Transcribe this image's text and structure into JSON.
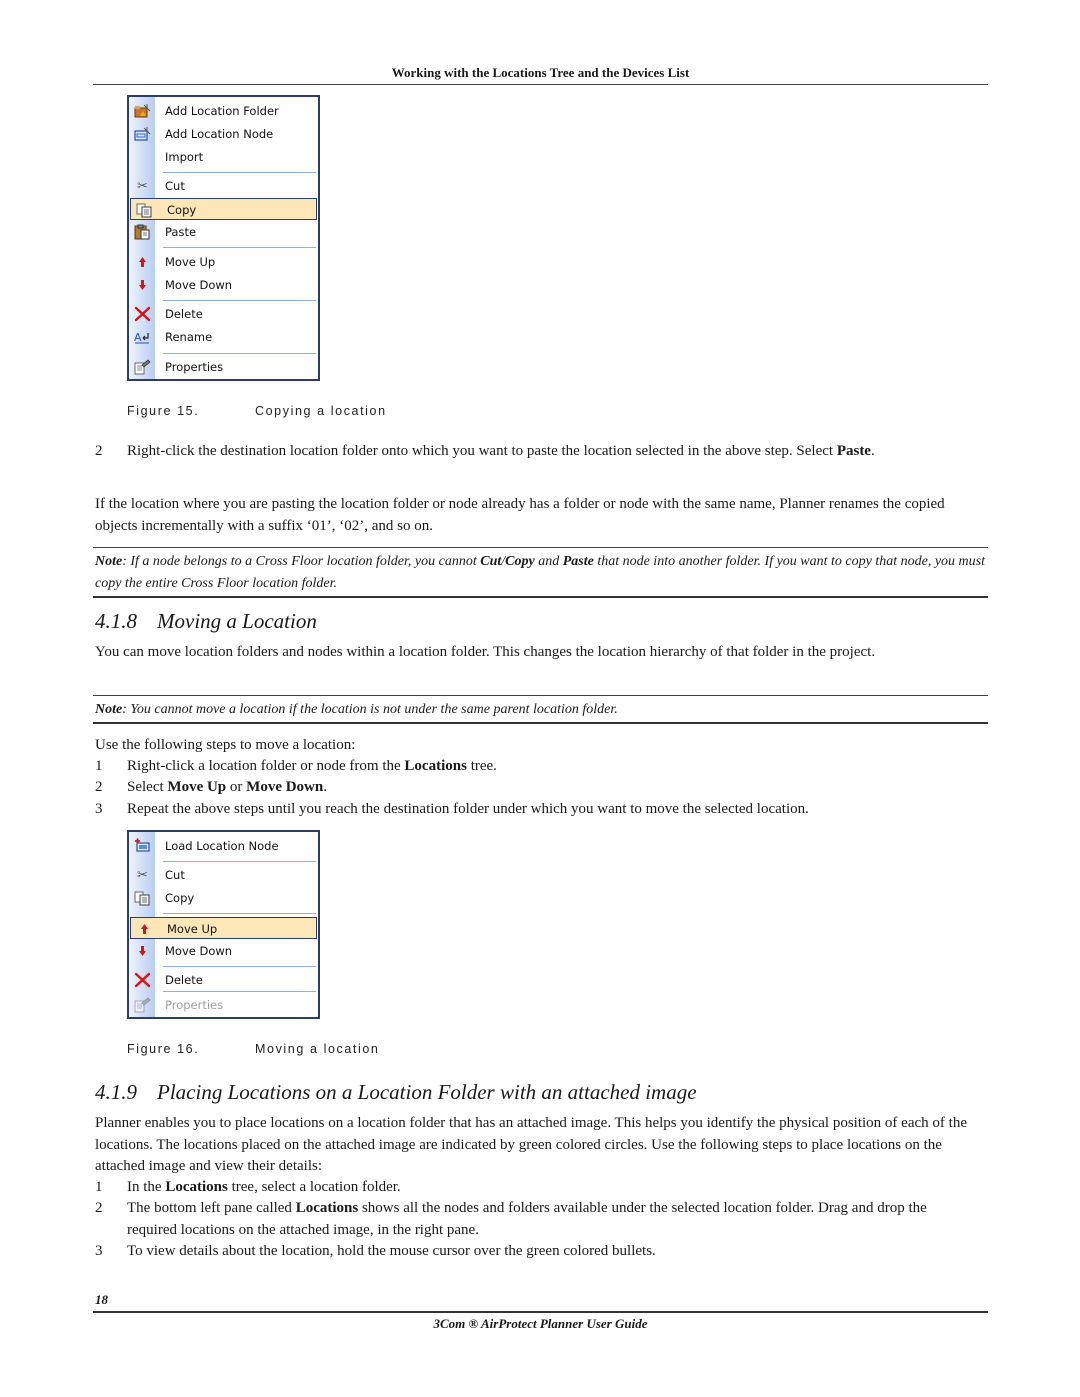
{
  "header": {
    "running_title": "Working with the Locations Tree and the Devices List"
  },
  "figure15": {
    "menu_items": [
      {
        "label": "Add Location Folder",
        "icon": "add-folder-icon"
      },
      {
        "label": "Add Location Node",
        "icon": "add-node-icon"
      },
      {
        "label": "Import",
        "icon": ""
      },
      {
        "label": "Cut",
        "icon": "scissors-icon"
      },
      {
        "label": "Copy",
        "icon": "copy-icon",
        "selected": true
      },
      {
        "label": "Paste",
        "icon": "paste-icon"
      },
      {
        "label": "Move Up",
        "icon": "arrow-up-icon"
      },
      {
        "label": "Move Down",
        "icon": "arrow-down-icon"
      },
      {
        "label": "Delete",
        "icon": "delete-x-icon"
      },
      {
        "label": "Rename",
        "icon": "rename-icon"
      },
      {
        "label": "Properties",
        "icon": "properties-icon"
      }
    ],
    "caption_number": "Figure 15.",
    "caption_text": "Copying a location"
  },
  "section_copy": {
    "step2_num": "2",
    "step2_text_a": "Right-click the destination location folder onto which you want to paste the location selected in the above step. Select ",
    "step2_bold": "Paste",
    "step2_text_b": ".",
    "paragraph": "If the location where you are pasting the location folder or node already has a folder or node with the same name, Planner renames the copied objects incrementally with a suffix ‘01’, ‘02’, and so on.",
    "note_label": "Note",
    "note_a": ": If a node belongs to a Cross Floor location folder, you cannot ",
    "note_b1": "Cut",
    "note_slash": "/",
    "note_b2": "Copy",
    "note_c": " and ",
    "note_b3": "Paste",
    "note_d": " that node into another folder. If you want to copy that node, you must copy the entire Cross Floor location folder."
  },
  "section_418": {
    "number": "4.1.8",
    "title": "Moving a Location",
    "paragraph": "You can move location folders and nodes within a location folder. This changes the location hierarchy of that folder in the project.",
    "note_label": "Note",
    "note_text": ": You cannot move a location if the location is not under the same parent location folder.",
    "intro": "Use the following steps to move a location:",
    "steps": [
      {
        "n": "1",
        "a": "Right-click a location folder or node from the ",
        "b": "Locations",
        "c": " tree."
      },
      {
        "n": "2",
        "a": "Select ",
        "b": "Move Up",
        "c": " or ",
        "d": "Move Down",
        "e": "."
      },
      {
        "n": "3",
        "a": "Repeat the above steps until you reach the destination folder under which you want to move the selected location."
      }
    ]
  },
  "figure16": {
    "menu_items": [
      {
        "label": "Load Location Node",
        "icon": "load-node-icon"
      },
      {
        "label": "Cut",
        "icon": "scissors-icon"
      },
      {
        "label": "Copy",
        "icon": "copy-icon"
      },
      {
        "label": "Move Up",
        "icon": "arrow-up-icon",
        "selected": true
      },
      {
        "label": "Move Down",
        "icon": "arrow-down-icon"
      },
      {
        "label": "Delete",
        "icon": "delete-x-icon"
      },
      {
        "label": "Properties",
        "icon": "properties-icon",
        "disabled": true
      }
    ],
    "caption_number": "Figure 16.",
    "caption_text": "Moving a location"
  },
  "section_419": {
    "number": "4.1.9",
    "title": "Placing Locations on a Location Folder with an attached image",
    "paragraph": "Planner enables you to place locations on a location folder that has an attached image. This helps you identify the physical position of each of the locations. The locations placed on the attached image are indicated by green colored circles. Use the following steps to place locations on the attached image and view their details:",
    "steps": [
      {
        "n": "1",
        "a": "In the ",
        "b": "Locations",
        "c": " tree, select a location folder."
      },
      {
        "n": "2",
        "a": "The bottom left pane called ",
        "b": "Locations",
        "c": " shows all the nodes and folders available under the selected location folder. Drag and drop the required locations on the attached image, in the right pane."
      },
      {
        "n": "3",
        "a": "To view details about the location, hold the mouse cursor over the green colored bullets."
      }
    ]
  },
  "footer": {
    "page_number": "18",
    "guide_title": "3Com ® AirProtect Planner User Guide"
  },
  "colors": {
    "menu_border": "#2a3d6b",
    "menu_highlight": "#fde6b8",
    "menu_separator": "#8fb0dc",
    "icon_red": "#d01818"
  }
}
